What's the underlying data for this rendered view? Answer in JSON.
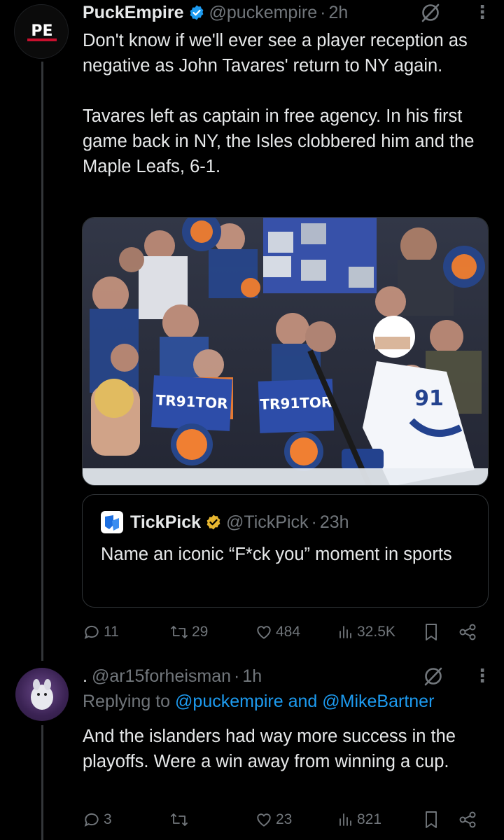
{
  "tweet": {
    "author_name": "PuckEmpire",
    "handle": "@puckempire",
    "separator": "·",
    "time": "2h",
    "avatar_text": "PE",
    "text": "Don't know if we'll ever see a player reception as negative as John Tavares' return to NY again.\n\nTavares left as captain in free agency. In his first game back in NY, the Isles clobbered him and the Maple Leafs, 6-1.",
    "media": {
      "sign_left": "TR91TOR",
      "sign_right": "TR91TOR",
      "jersey_number": "91"
    },
    "quote": {
      "author_name": "TickPick",
      "handle": "@TickPick",
      "separator": "·",
      "time": "23h",
      "text": "Name an iconic “F*ck you” moment in sports"
    },
    "stats": {
      "replies": "11",
      "reposts": "29",
      "likes": "484",
      "views": "32.5K"
    }
  },
  "reply": {
    "prefix": ".",
    "handle": "@ar15forheisman",
    "separator": "·",
    "time": "1h",
    "replying_to_label": "Replying to",
    "replying_to_user1": "@puckempire",
    "replying_to_and": "and",
    "replying_to_user2": "@MikeBartner",
    "text": "And the islanders had way more success in the playoffs. Were a win away from winning a cup.",
    "stats": {
      "replies": "3",
      "reposts": "",
      "likes": "23",
      "views": "821"
    }
  },
  "colors": {
    "background": "#000000",
    "text": "#e7e9ea",
    "muted": "#71767b",
    "link": "#1d9bf0",
    "verified": "#1d9bf0",
    "gold": "#e8b730"
  }
}
